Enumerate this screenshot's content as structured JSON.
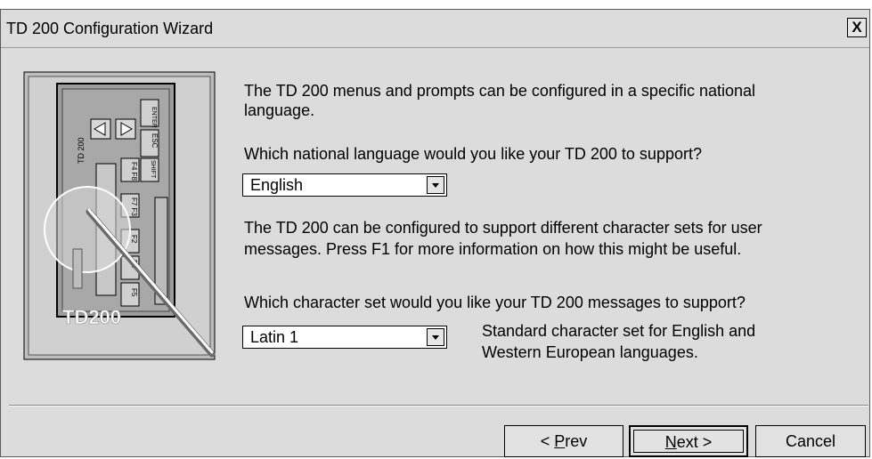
{
  "window": {
    "title": "TD 200 Configuration Wizard",
    "close_label": "X"
  },
  "illustration": {
    "device_label": "TD200",
    "side_label": "TD 200",
    "keys": [
      "ENTER",
      "ESC",
      "F4 F8",
      "SHIFT",
      "F7 F3",
      "F2",
      "F6",
      "F5"
    ]
  },
  "content": {
    "intro_line1": "The TD 200 menus and prompts can be configured in a specific national",
    "intro_line2": "language.",
    "language_question": "Which national language would you like your TD 200 to support?",
    "language_selected": "English",
    "charset_info_line1": "The TD 200 can be configured to support different character sets for user",
    "charset_info_line2": "messages. Press F1 for more information on how this might be useful.",
    "charset_question": "Which character set would you like your TD 200 messages to support?",
    "charset_selected": "Latin 1",
    "charset_desc_line1": "Standard character set for English and",
    "charset_desc_line2": "Western European languages."
  },
  "buttons": {
    "prev_prefix": "< ",
    "prev_accel": "P",
    "prev_rest": "rev",
    "next_accel": "N",
    "next_rest": "ext >",
    "cancel": "Cancel"
  }
}
